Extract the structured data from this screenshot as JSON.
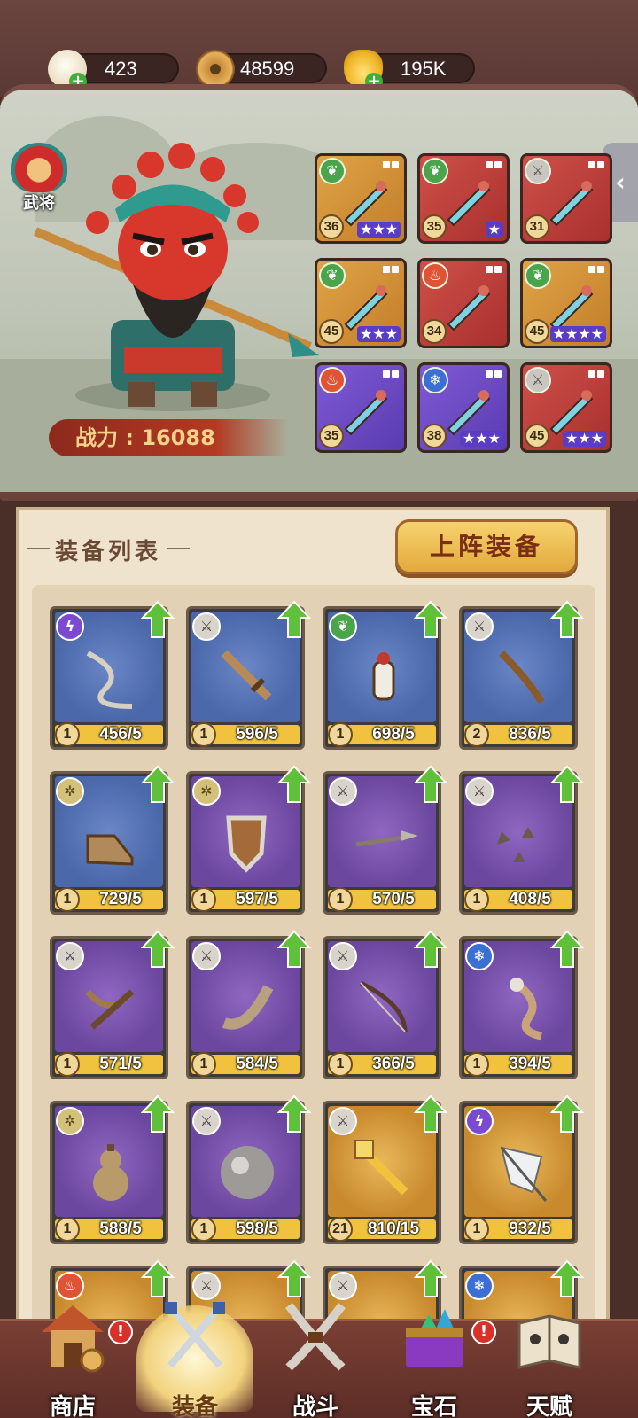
{
  "resources": [
    {
      "icon": "bun-icon",
      "value": "423"
    },
    {
      "icon": "coin-icon",
      "value": "48599"
    },
    {
      "icon": "gold-ingot-icon",
      "value": "195K"
    }
  ],
  "hero": {
    "rank_label": "武将",
    "power_label": "战力",
    "power_value": "16088"
  },
  "equipped": [
    {
      "rarity": "gold",
      "element": "nature",
      "level": "36",
      "stars": "★★★"
    },
    {
      "rarity": "red",
      "element": "nature",
      "level": "35",
      "stars": "★"
    },
    {
      "rarity": "red",
      "element": "sword",
      "level": "31",
      "stars": ""
    },
    {
      "rarity": "gold",
      "element": "nature",
      "level": "45",
      "stars": "★★★"
    },
    {
      "rarity": "red",
      "element": "fire",
      "level": "34",
      "stars": ""
    },
    {
      "rarity": "gold",
      "element": "nature",
      "level": "45",
      "stars": "★★★★"
    },
    {
      "rarity": "purple",
      "element": "fire",
      "level": "35",
      "stars": ""
    },
    {
      "rarity": "purple",
      "element": "ice",
      "level": "38",
      "stars": "★★★"
    },
    {
      "rarity": "red",
      "element": "sword",
      "level": "45",
      "stars": "★★★"
    }
  ],
  "list": {
    "title": "装备列表",
    "deploy_button": "上阵装备",
    "items": [
      {
        "rarity": "blue",
        "type": "lightning",
        "count": "1",
        "progress": "456/5"
      },
      {
        "rarity": "blue",
        "type": "sword",
        "count": "1",
        "progress": "596/5"
      },
      {
        "rarity": "blue",
        "type": "nature",
        "count": "1",
        "progress": "698/5"
      },
      {
        "rarity": "blue",
        "type": "sword",
        "count": "2",
        "progress": "836/5"
      },
      {
        "rarity": "blue",
        "type": "spark",
        "count": "1",
        "progress": "729/5"
      },
      {
        "rarity": "purple",
        "type": "spark",
        "count": "1",
        "progress": "597/5"
      },
      {
        "rarity": "purple",
        "type": "sword",
        "count": "1",
        "progress": "570/5"
      },
      {
        "rarity": "purple",
        "type": "sword",
        "count": "1",
        "progress": "408/5"
      },
      {
        "rarity": "purple",
        "type": "sword",
        "count": "1",
        "progress": "571/5"
      },
      {
        "rarity": "purple",
        "type": "sword",
        "count": "1",
        "progress": "584/5"
      },
      {
        "rarity": "purple",
        "type": "sword",
        "count": "1",
        "progress": "366/5"
      },
      {
        "rarity": "purple",
        "type": "ice",
        "count": "1",
        "progress": "394/5"
      },
      {
        "rarity": "purple",
        "type": "spark",
        "count": "1",
        "progress": "588/5"
      },
      {
        "rarity": "purple",
        "type": "sword",
        "count": "1",
        "progress": "598/5"
      },
      {
        "rarity": "gold",
        "type": "sword",
        "count": "21",
        "progress": "810/15"
      },
      {
        "rarity": "gold",
        "type": "lightning",
        "count": "1",
        "progress": "932/5"
      },
      {
        "rarity": "gold",
        "type": "fire",
        "count": "",
        "progress": ""
      },
      {
        "rarity": "gold",
        "type": "sword",
        "count": "",
        "progress": ""
      },
      {
        "rarity": "gold",
        "type": "sword",
        "count": "",
        "progress": ""
      },
      {
        "rarity": "gold",
        "type": "ice",
        "count": "",
        "progress": ""
      }
    ]
  },
  "nav": [
    {
      "label": "商店",
      "icon": "shop-icon",
      "alert": true
    },
    {
      "label": "装备",
      "icon": "equipment-icon",
      "alert": false,
      "active": true
    },
    {
      "label": "战斗",
      "icon": "battle-icon",
      "alert": false
    },
    {
      "label": "宝石",
      "icon": "gem-chest-icon",
      "alert": true
    },
    {
      "label": "天赋",
      "icon": "talent-book-icon",
      "alert": false
    }
  ]
}
